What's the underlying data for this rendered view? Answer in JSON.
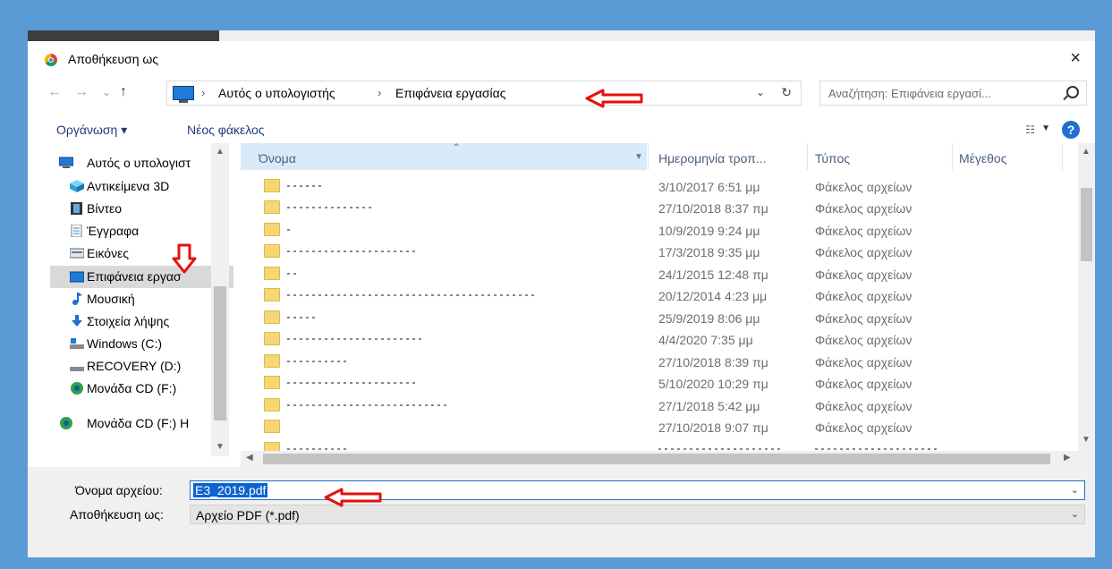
{
  "dialog": {
    "title": "Αποθήκευση ως",
    "close_symbol": "×"
  },
  "nav": {
    "back": "←",
    "forward": "→",
    "recent": "⌄",
    "up": "↑"
  },
  "address": {
    "crumbs": [
      "Αυτός ο υπολογιστής",
      "Επιφάνεια εργασίας"
    ],
    "separator": "›",
    "dropdown": "⌄",
    "refresh": "↻"
  },
  "search": {
    "placeholder": "Αναζήτηση: Επιφάνεια εργασί..."
  },
  "toolbar": {
    "organize": "Οργάνωση ▾",
    "new_folder": "Νέος φάκελος",
    "view_icon": "☷",
    "view_dd": "▼",
    "help": "?"
  },
  "sidebar": {
    "items": [
      {
        "label": "Αυτός ο υπολογιστ",
        "icon": "computer-icon",
        "selected": false
      },
      {
        "label": "Αντικείμενα 3D",
        "icon": "cube-icon",
        "selected": false
      },
      {
        "label": "Βίντεο",
        "icon": "video-icon",
        "selected": false
      },
      {
        "label": "Έγγραφα",
        "icon": "document-icon",
        "selected": false
      },
      {
        "label": "Εικόνες",
        "icon": "pictures-icon",
        "selected": false
      },
      {
        "label": "Επιφάνεια εργασ",
        "icon": "desktop-icon",
        "selected": true
      },
      {
        "label": "Μουσική",
        "icon": "music-icon",
        "selected": false
      },
      {
        "label": "Στοιχεία λήψης",
        "icon": "download-icon",
        "selected": false
      },
      {
        "label": "Windows (C:)",
        "icon": "drive-icon",
        "selected": false
      },
      {
        "label": "RECOVERY (D:)",
        "icon": "drive-icon",
        "selected": false
      },
      {
        "label": "Μονάδα CD (F:)",
        "icon": "cd-icon",
        "selected": false
      },
      {
        "label": "Μονάδα CD (F:) H",
        "icon": "cd-icon",
        "selected": false
      }
    ]
  },
  "columns": {
    "name": "Όνομα",
    "date": "Ημερομηνία τροπ...",
    "type": "Τύπος",
    "size": "Μέγεθος"
  },
  "files": [
    {
      "date": "3/10/2017 6:51 μμ",
      "type": "Φάκελος αρχείων"
    },
    {
      "date": "27/10/2018 8:37 πμ",
      "type": "Φάκελος αρχείων"
    },
    {
      "date": "10/9/2019 9:24 μμ",
      "type": "Φάκελος αρχείων"
    },
    {
      "date": "17/3/2018 9:35 μμ",
      "type": "Φάκελος αρχείων"
    },
    {
      "date": "24/1/2015 12:48 πμ",
      "type": "Φάκελος αρχείων"
    },
    {
      "date": "20/12/2014 4:23 μμ",
      "type": "Φάκελος αρχείων"
    },
    {
      "date": "25/9/2019 8:06 μμ",
      "type": "Φάκελος αρχείων"
    },
    {
      "date": "4/4/2020 7:35 μμ",
      "type": "Φάκελος αρχείων"
    },
    {
      "date": "27/10/2018 8:39 πμ",
      "type": "Φάκελος αρχείων"
    },
    {
      "date": "5/10/2020 10:29 πμ",
      "type": "Φάκελος αρχείων"
    },
    {
      "date": "27/1/2018 5:42 μμ",
      "type": "Φάκελος αρχείων"
    },
    {
      "date": "27/10/2018 9:07 πμ",
      "type": "Φάκελος αρχείων"
    }
  ],
  "form": {
    "filename_label": "Όνομα αρχείου:",
    "filename_value": "E3_2019.pdf",
    "savetype_label": "Αποθήκευση ως:",
    "savetype_value": "Αρχείο PDF (*.pdf)",
    "dropdown": "⌄"
  },
  "colors": {
    "background": "#5b9bd5",
    "accent": "#1f6fd0",
    "arrow": "#e3120b",
    "folder": "#f7d674"
  }
}
